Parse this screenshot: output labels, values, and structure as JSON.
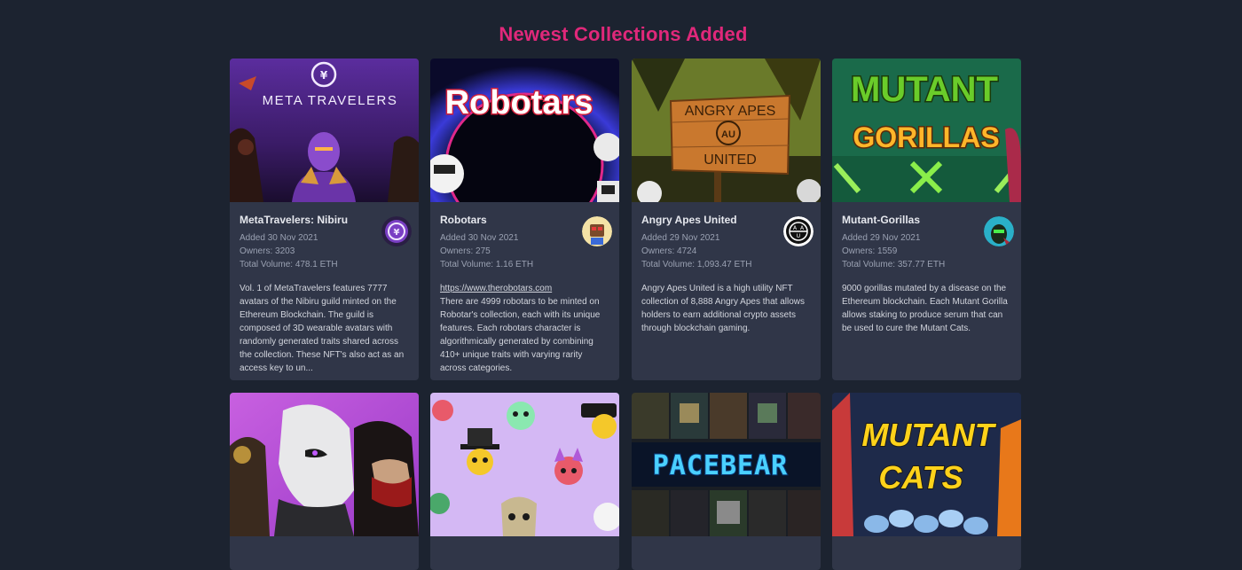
{
  "page_title": "Newest Collections Added",
  "cards": [
    {
      "title": "MetaTravelers: Nibiru",
      "added": "Added 30 Nov 2021",
      "owners": "Owners: 3203",
      "volume": "Total Volume: 478.1 ETH",
      "link": "",
      "description": "Vol. 1 of MetaTravelers features 7777 avatars of the Nibiru guild minted on the Ethereum Blockchain. The guild is composed of 3D wearable avatars with randomly generated traits shared across the collection. These NFT's also act as an access key to un...",
      "banner_text": "META TRAVELERS",
      "avatar_icon": "metatravelers-logo-icon"
    },
    {
      "title": "Robotars",
      "added": "Added 30 Nov 2021",
      "owners": "Owners: 275",
      "volume": "Total Volume: 1.16 ETH",
      "link": "https://www.therobotars.com",
      "description": "There are 4999 robotars to be minted on Robotar's collection, each with its unique features. Each robotars character is algorithmically generated by combining 410+ unique traits with varying rarity across categories.",
      "banner_text": "Robotars",
      "avatar_icon": "robot-avatar-icon"
    },
    {
      "title": "Angry Apes United",
      "added": "Added 29 Nov 2021",
      "owners": "Owners: 4724",
      "volume": "Total Volume: 1,093.47 ETH",
      "link": "",
      "description": "Angry Apes United is a high utility NFT collection of 8,888 Angry Apes that allows holders to earn additional crypto assets through blockchain gaming.",
      "banner_text_top": "ANGRY APES",
      "banner_text_bottom": "UNITED",
      "avatar_icon": "aau-logo-icon"
    },
    {
      "title": "Mutant-Gorillas",
      "added": "Added 29 Nov 2021",
      "owners": "Owners: 1559",
      "volume": "Total Volume: 357.77 ETH",
      "link": "",
      "description": "9000 gorillas mutated by a disease on the Ethereum blockchain. Each Mutant Gorilla allows staking to produce serum that can be used to cure the Mutant Cats.",
      "banner_text_top": "MUTANT",
      "banner_text_bottom": "GORILLAS",
      "avatar_icon": "gorilla-avatar-icon"
    },
    {
      "banner_icon": "masked-characters-art"
    },
    {
      "banner_icon": "skulls-pattern-art"
    },
    {
      "banner_text": "PACEBEAR",
      "banner_icon": "pixel-bears-art"
    },
    {
      "banner_text_top": "MUTANT",
      "banner_text_bottom": "CATS",
      "banner_icon": "mutant-cats-art"
    }
  ],
  "colors": {
    "background": "#1c2330",
    "card": "#303648",
    "title_accent": "#e0287a"
  }
}
